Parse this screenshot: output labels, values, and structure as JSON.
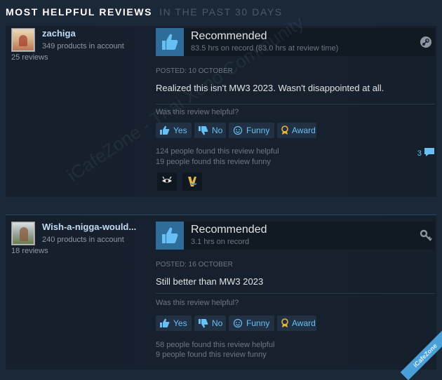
{
  "section": {
    "title": "Most Helpful Reviews",
    "subtitle": "In the past 30 days"
  },
  "reviews": [
    {
      "author": {
        "name": "zachiga",
        "products": "349 products in account",
        "reviews": "25 reviews",
        "avatar": "avatar-image"
      },
      "verdict": "Recommended",
      "hours": "83.5 hrs on record (83.0 hrs at review time)",
      "corner_icon": "steam-logo-icon",
      "posted": "Posted: 10 October",
      "text": "Realized this isn't MW3 2023. Wasn't disappointed at all.",
      "helpful_question": "Was this review helpful?",
      "buttons": {
        "yes": "Yes",
        "no": "No",
        "funny": "Funny",
        "award": "Award"
      },
      "helpful_count": "124 people found this review helpful",
      "funny_count": "19 people found this review funny",
      "comments": "3",
      "awards": [
        "award-badge-1",
        "award-badge-2"
      ]
    },
    {
      "author": {
        "name": "Wish-a-nigga-would...",
        "products": "240 products in account",
        "reviews": "18 reviews",
        "avatar": "avatar-image"
      },
      "verdict": "Recommended",
      "hours": "3.1 hrs on record",
      "corner_icon": "key-icon",
      "posted": "Posted: 16 October",
      "text": "Still better than MW3 2023",
      "helpful_question": "Was this review helpful?",
      "buttons": {
        "yes": "Yes",
        "no": "No",
        "funny": "Funny",
        "award": "Award"
      },
      "helpful_count": "58 people found this review helpful",
      "funny_count": "9 people found this review funny"
    }
  ],
  "overlay": {
    "watermark": "iCafeZone - Thai Xeno Community",
    "badge": "iCafeZone"
  },
  "colors": {
    "background": "#1b2838",
    "accent": "#67c1f5",
    "thumb_box": "#2e6c99"
  }
}
